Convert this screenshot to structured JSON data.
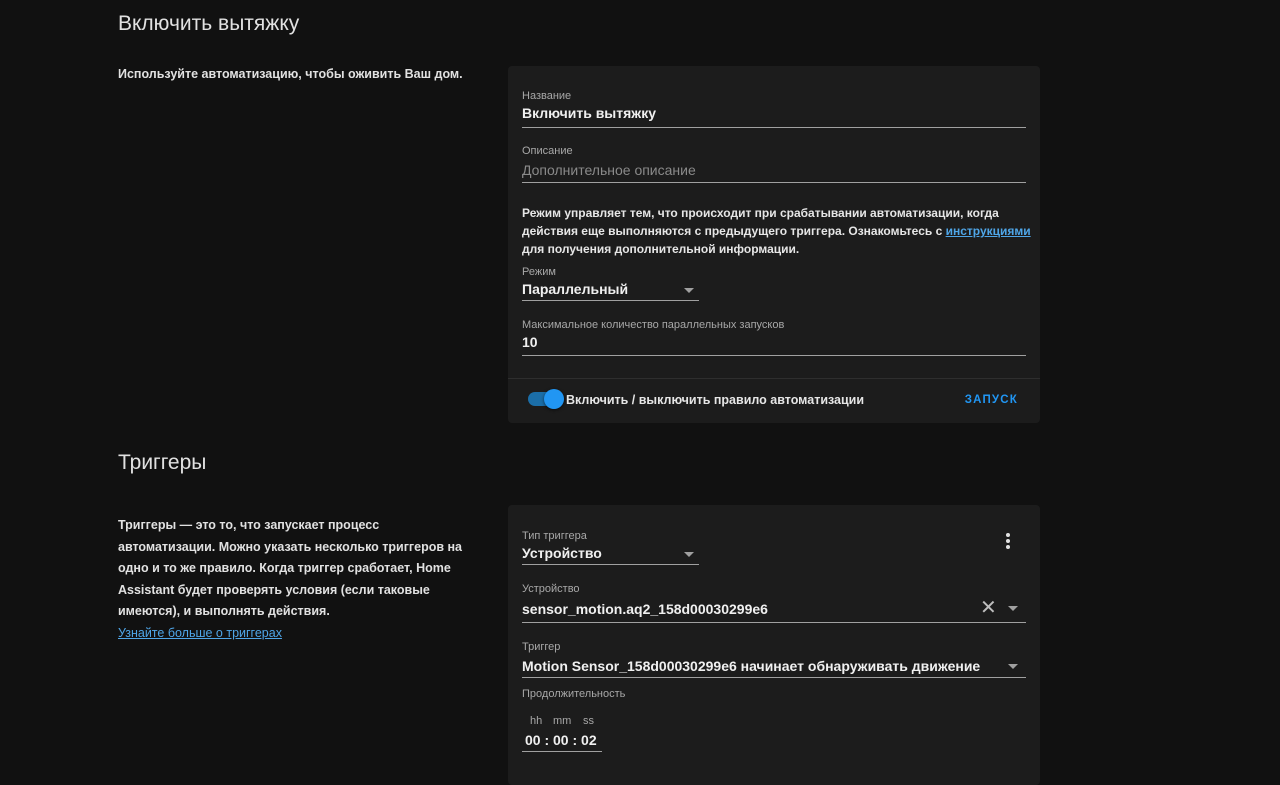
{
  "automation": {
    "title": "Включить вытяжку",
    "intro": "Используйте автоматизацию, чтобы оживить Ваш дом.",
    "name_label": "Название",
    "name_value": "Включить вытяжку",
    "description_label": "Описание",
    "description_placeholder": "Дополнительное описание",
    "mode_text_before": "Режим управляет тем, что происходит при срабатывании автоматизации, когда действия еще выполняются с предыдущего триггера. Ознакомьтесь с ",
    "mode_link": "инструкциями",
    "mode_text_after": " для получения дополнительной информации.",
    "mode_label": "Режим",
    "mode_value": "Параллельный",
    "max_label": "Максимальное количество параллельных запусков",
    "max_value": "10",
    "toggle_label": "Включить / выключить правило автоматизации",
    "toggle_on": true,
    "run_label": "ЗАПУСК"
  },
  "triggers": {
    "title": "Триггеры",
    "intro": "Триггеры — это то, что запускает процесс автоматизации. Можно указать несколько триггеров на одно и то же правило. Когда триггер сработает, Home Assistant будет проверять условия (если таковые имеются), и выполнять действия.",
    "learn_more": "Узнайте больше о триггерах",
    "type_label": "Тип триггера",
    "type_value": "Устройство",
    "device_label": "Устройство",
    "device_value": "sensor_motion.aq2_158d00030299e6",
    "trigger_label": "Триггер",
    "trigger_value": "Motion Sensor_158d00030299e6 начинает обнаруживать движение",
    "duration_label": "Продолжительность",
    "duration_hh_label": "hh",
    "duration_mm_label": "mm",
    "duration_ss_label": "ss",
    "duration_value": "00 : 00 : 02"
  },
  "colors": {
    "background": "#111111",
    "card": "#1c1c1c",
    "accent": "#2196f3",
    "link": "#4fa6e8"
  }
}
